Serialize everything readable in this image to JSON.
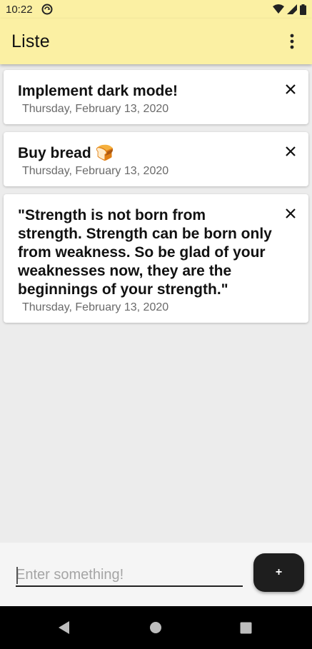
{
  "status_bar": {
    "time": "10:22",
    "icons": [
      "sync-circle-icon",
      "wifi-icon",
      "cell-signal-icon",
      "battery-icon"
    ]
  },
  "app_bar": {
    "title": "Liste",
    "menu_icon": "more-vert-icon"
  },
  "items": [
    {
      "title": "Implement dark mode!",
      "date": "Thursday, February 13, 2020"
    },
    {
      "title": "Buy bread 🍞",
      "date": "Thursday, February 13, 2020"
    },
    {
      "title": "\"Strength is not born from strength. Strength can be born only from weakness. So be glad of your weaknesses now, they are the beginnings of your strength.\"",
      "date": "Thursday, February 13, 2020"
    }
  ],
  "input": {
    "placeholder": "Enter something!",
    "value": ""
  },
  "add_button": {
    "label": "+"
  },
  "colors": {
    "app_bar": "#fbf0a3",
    "background": "#ececec",
    "fab": "#1e1e1e",
    "nav_bar": "#000000"
  }
}
